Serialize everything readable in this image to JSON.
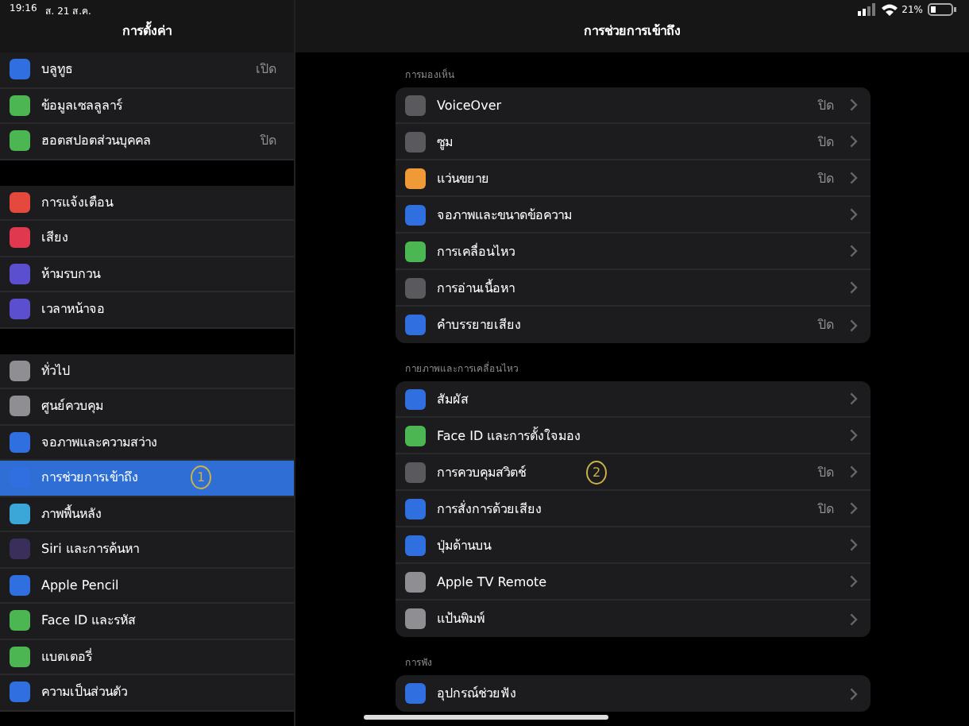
{
  "status_bar": {
    "time": "19:16",
    "date": "ส. 21 ส.ค.",
    "battery_text": "21%"
  },
  "sidebar": {
    "title": "การตั้งค่า",
    "groups": [
      {
        "items": [
          {
            "label": "บลูทูธ",
            "value": "เปิด",
            "color": "#2f6fe0",
            "selected": false
          },
          {
            "label": "ข้อมูลเซลลูลาร์",
            "color": "#4cb752",
            "selected": false
          },
          {
            "label": "ฮอตสปอตส่วนบุคคล",
            "value": "ปิด",
            "color": "#4cb752",
            "selected": false
          }
        ]
      },
      {
        "items": [
          {
            "label": "การแจ้งเตือน",
            "color": "#e5483d",
            "selected": false
          },
          {
            "label": "เสียง",
            "color": "#e0384f",
            "selected": false
          },
          {
            "label": "ห้ามรบกวน",
            "color": "#5b4fcf",
            "selected": false
          },
          {
            "label": "เวลาหน้าจอ",
            "color": "#5b4fcf",
            "selected": false
          }
        ]
      },
      {
        "items": [
          {
            "label": "ทั่วไป",
            "color": "#8e8e93",
            "selected": false
          },
          {
            "label": "ศูนย์ควบคุม",
            "color": "#8e8e93",
            "selected": false
          },
          {
            "label": "จอภาพและความสว่าง",
            "color": "#2f6fe0",
            "selected": false
          },
          {
            "label": "การช่วยการเข้าถึง",
            "color": "#2f6fe0",
            "selected": true,
            "annotation": "1"
          },
          {
            "label": "ภาพพื้นหลัง",
            "color": "#3aa7d8",
            "selected": false
          },
          {
            "label": "Siri และการค้นหา",
            "color": "#3a2e5a",
            "selected": false
          },
          {
            "label": "Apple Pencil",
            "color": "#2f6fe0",
            "selected": false
          },
          {
            "label": "Face ID และรหัส",
            "color": "#4cb752",
            "selected": false
          },
          {
            "label": "แบตเตอรี่",
            "color": "#4cb752",
            "selected": false
          },
          {
            "label": "ความเป็นส่วนตัว",
            "color": "#2f6fe0",
            "selected": false
          }
        ]
      }
    ]
  },
  "detail": {
    "title": "การช่วยการเข้าถึง",
    "sections": [
      {
        "header": "การมองเห็น",
        "items": [
          {
            "label": "VoiceOver",
            "value": "ปิด",
            "color": "#5a5a5e"
          },
          {
            "label": "ซูม",
            "value": "ปิด",
            "color": "#5a5a5e"
          },
          {
            "label": "แว่นขยาย",
            "value": "ปิด",
            "color": "#f09a37"
          },
          {
            "label": "จอภาพและขนาดข้อความ",
            "color": "#2f6fe0"
          },
          {
            "label": "การเคลื่อนไหว",
            "color": "#4cb752"
          },
          {
            "label": "การอ่านเนื้อหา",
            "color": "#5a5a5e"
          },
          {
            "label": "คำบรรยายเสียง",
            "value": "ปิด",
            "color": "#2f6fe0"
          }
        ]
      },
      {
        "header": "กายภาพและการเคลื่อนไหว",
        "items": [
          {
            "label": "สัมผัส",
            "color": "#2f6fe0"
          },
          {
            "label": "Face ID และการตั้งใจมอง",
            "color": "#4cb752"
          },
          {
            "label": "การควบคุมสวิตช์",
            "value": "ปิด",
            "color": "#5a5a5e",
            "annotation": "2"
          },
          {
            "label": "การสั่งการด้วยเสียง",
            "value": "ปิด",
            "color": "#2f6fe0"
          },
          {
            "label": "ปุ่มด้านบน",
            "color": "#2f6fe0"
          },
          {
            "label": "Apple TV Remote",
            "color": "#8e8e93"
          },
          {
            "label": "แป้นพิมพ์",
            "color": "#8e8e93"
          }
        ]
      },
      {
        "header": "การฟัง",
        "items": [
          {
            "label": "อุปกรณ์ช่วยฟัง",
            "color": "#2f6fe0"
          }
        ]
      }
    ]
  }
}
